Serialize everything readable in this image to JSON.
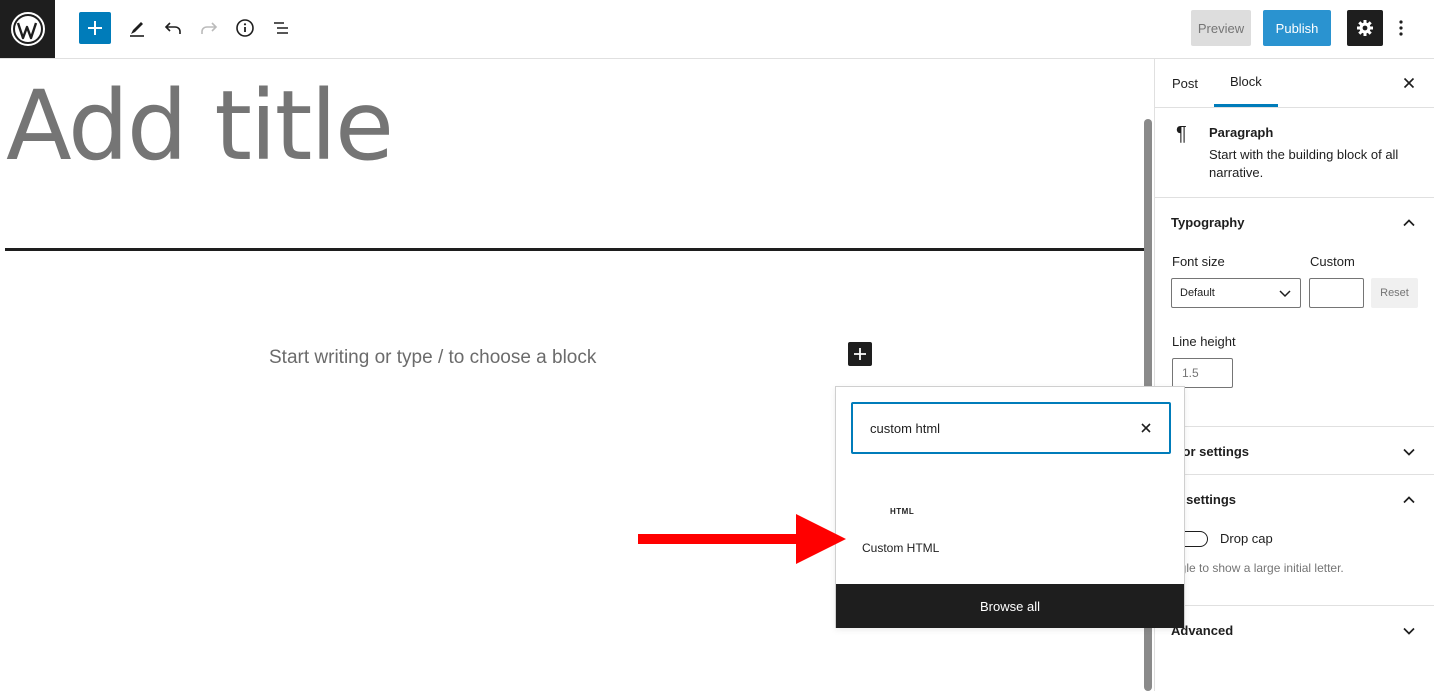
{
  "toolbar": {
    "logo_icon": "wordpress-logo-icon",
    "add_icon": "plus-icon",
    "tools_icon": "pencil-icon",
    "undo_icon": "undo-icon",
    "redo_icon": "redo-icon",
    "details_icon": "info-icon",
    "outline_icon": "list-view-icon",
    "preview_label": "Preview",
    "publish_label": "Publish",
    "settings_icon": "gear-icon",
    "more_icon": "more-vertical-icon"
  },
  "editor": {
    "title_placeholder": "Add title",
    "block_placeholder": "Start writing or type / to choose a block"
  },
  "sidebar": {
    "tabs": [
      {
        "label": "Post",
        "active": false
      },
      {
        "label": "Block",
        "active": true
      }
    ],
    "block_card": {
      "name": "Paragraph",
      "description": "Start with the building block of all narrative.",
      "icon": "paragraph-icon"
    },
    "typography": {
      "title": "Typography",
      "font_size_label": "Font size",
      "custom_label": "Custom",
      "font_size_value": "Default",
      "custom_value": "",
      "reset_label": "Reset",
      "line_height_label": "Line height",
      "line_height_placeholder": "1.5"
    },
    "color_settings_title": "olor settings",
    "text_settings": {
      "title": "xt settings",
      "drop_cap_label": "Drop cap",
      "drop_cap_enabled": false,
      "helper": "ggle to show a large initial letter."
    },
    "advanced_title": "Advanced"
  },
  "inserter": {
    "search_value": "custom html",
    "result": {
      "icon_text": "HTML",
      "label": "Custom HTML"
    },
    "browse_all_label": "Browse all"
  },
  "colors": {
    "accent": "#007cba",
    "publish": "#2a93d0",
    "dark": "#1e1e1e",
    "annotation_arrow": "#ff0000"
  }
}
